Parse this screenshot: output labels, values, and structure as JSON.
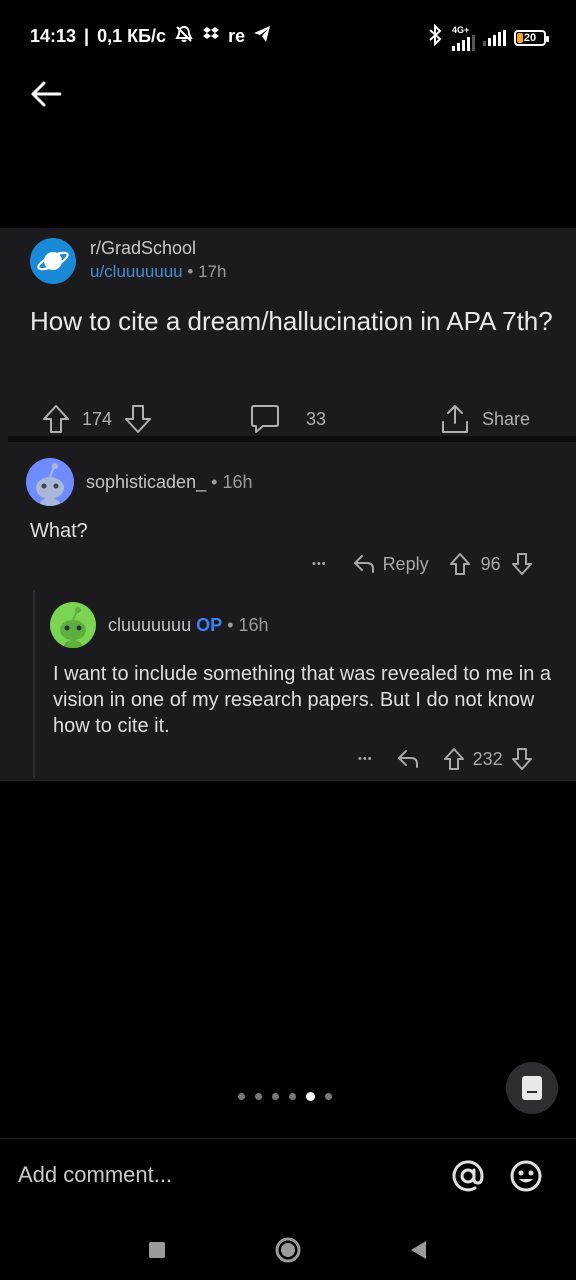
{
  "status_bar": {
    "time": "14:13",
    "separator": "|",
    "speed": "0,1 КБ/с",
    "carrier_glyph": "re",
    "network_label": "4G+",
    "battery": "20",
    "battery_level": 0.2,
    "icons": [
      "alarm-off-icon",
      "dropbox-icon",
      "telegram-icon",
      "bluetooth-icon",
      "signal-icon",
      "battery-icon"
    ]
  },
  "post": {
    "subreddit": "r/GradSchool",
    "author": "u/cluuuuuuu",
    "meta_separator": "•",
    "time": "17h",
    "title": "How to cite a dream/hallucination in APA 7th?",
    "upvotes": "174",
    "comments": "33",
    "share_label": "Share"
  },
  "comments": [
    {
      "user": "sophisticaden_",
      "separator": "•",
      "time": "16h",
      "body": "What?",
      "more": "•••",
      "reply_label": "Reply",
      "votes": "96",
      "avatar_color": "#6f8cff"
    },
    {
      "user": "cluuuuuuu",
      "op_label": "OP",
      "separator": "•",
      "time": "16h",
      "body": "I want to include something that was revealed to me in a vision in one of my research papers. But I do not know how to cite it.",
      "more": "•••",
      "votes": "232",
      "avatar_color": "#7bd453"
    }
  ],
  "comment_bar": {
    "placeholder": "Add comment..."
  },
  "pager": {
    "count": 6,
    "active_index": 4
  },
  "colors": {
    "background": "#000000",
    "card": "#1b1b1d",
    "link_blue": "#4a8ad4",
    "op_blue": "#3b82f6",
    "subreddit_icon": "#1a8ad6"
  }
}
